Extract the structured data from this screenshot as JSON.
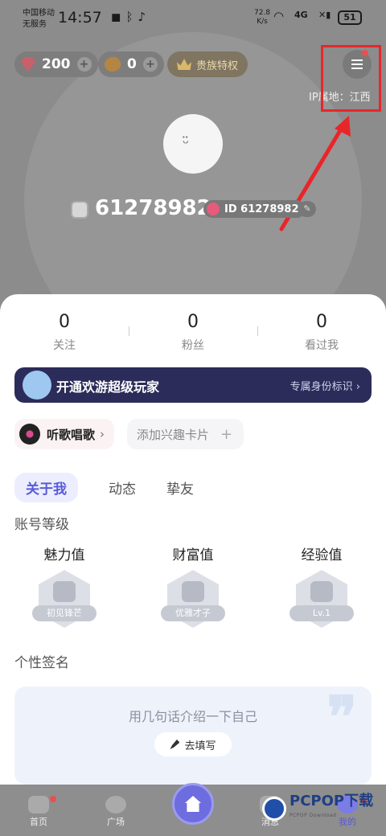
{
  "status_bar": {
    "carrier_line1": "中国移动",
    "carrier_line2": "无服务",
    "time": "14:57",
    "net_speed_value": "72.8",
    "net_speed_unit": "K/s",
    "signal_label": "4G",
    "battery": "51"
  },
  "header": {
    "gems": "200",
    "beans": "0",
    "noble_label": "贵族特权",
    "ip_location": "IP属地：江西"
  },
  "profile": {
    "nickname": "61278982",
    "id_label": "ID 61278982"
  },
  "stats": [
    {
      "value": "0",
      "label": "关注"
    },
    {
      "value": "0",
      "label": "粉丝"
    },
    {
      "value": "0",
      "label": "看过我"
    }
  ],
  "vip_banner": {
    "title": "开通欢游超级玩家",
    "subtitle": "专属身份标识",
    "arrow": "›"
  },
  "tags": {
    "song": "听歌唱歌",
    "song_arrow": "›",
    "add_card": "添加兴趣卡片",
    "add_icon": "+"
  },
  "tabs": [
    "关于我",
    "动态",
    "挚友"
  ],
  "account_level": {
    "title": "账号等级",
    "levels": [
      {
        "name": "魅力值",
        "badge": "初见锋芒"
      },
      {
        "name": "财富值",
        "badge": "优雅才子"
      },
      {
        "name": "经验值",
        "badge": "Lv.1"
      }
    ]
  },
  "signature": {
    "title": "个性签名",
    "placeholder": "用几句话介绍一下自己",
    "fill_button": "去填写"
  },
  "bottom_nav": [
    {
      "label": "首页"
    },
    {
      "label": "广场"
    },
    {
      "label": "消息"
    },
    {
      "label": "我的"
    }
  ],
  "watermark": {
    "brand": "PCPOP下载",
    "sub": "PCPOP Download"
  },
  "colors": {
    "accent": "#5a5ad8",
    "highlight_red": "#e8262a",
    "vip_bg": "#2c2c5a"
  }
}
